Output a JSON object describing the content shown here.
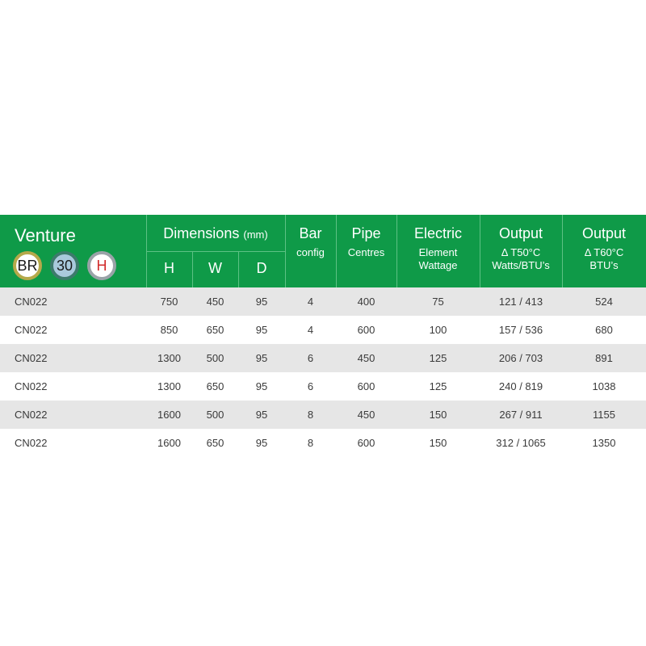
{
  "brand": {
    "title": "Venture",
    "badges": [
      {
        "label": "BR",
        "ring": "#b5a94a",
        "fill": "#ffffff",
        "text": "#1a1a1a"
      },
      {
        "label": "30",
        "ring": "#3d7a6c",
        "fill": "#a9c9dc",
        "text": "#1a1a1a"
      },
      {
        "label": "H",
        "ring": "#9aa3a8",
        "fill": "#ffffff",
        "text": "#d12c2c"
      }
    ]
  },
  "columns": {
    "dimensions": {
      "title": "Dimensions",
      "unit": "(mm)",
      "h": "H",
      "w": "W",
      "d": "D"
    },
    "bar": {
      "title": "Bar",
      "sub": "config"
    },
    "pipe": {
      "title": "Pipe",
      "sub": "Centres"
    },
    "electric": {
      "title": "Electric",
      "sub1": "Element",
      "sub2": "Wattage"
    },
    "output50": {
      "title": "Output",
      "sub1": "Δ T50°C",
      "sub2": "Watts/BTU’s"
    },
    "output60": {
      "title": "Output",
      "sub1": "Δ T60°C",
      "sub2": "BTU’s"
    }
  },
  "rows": [
    {
      "code": "CN022",
      "h": "750",
      "w": "450",
      "d": "95",
      "bar": "4",
      "pipe": "400",
      "watt": "75",
      "out50": "121 / 413",
      "out60": "524"
    },
    {
      "code": "CN022",
      "h": "850",
      "w": "650",
      "d": "95",
      "bar": "4",
      "pipe": "600",
      "watt": "100",
      "out50": "157 / 536",
      "out60": "680"
    },
    {
      "code": "CN022",
      "h": "1300",
      "w": "500",
      "d": "95",
      "bar": "6",
      "pipe": "450",
      "watt": "125",
      "out50": "206 / 703",
      "out60": "891"
    },
    {
      "code": "CN022",
      "h": "1300",
      "w": "650",
      "d": "95",
      "bar": "6",
      "pipe": "600",
      "watt": "125",
      "out50": "240 / 819",
      "out60": "1038"
    },
    {
      "code": "CN022",
      "h": "1600",
      "w": "500",
      "d": "95",
      "bar": "8",
      "pipe": "450",
      "watt": "150",
      "out50": "267 / 911",
      "out60": "1155"
    },
    {
      "code": "CN022",
      "h": "1600",
      "w": "650",
      "d": "95",
      "bar": "8",
      "pipe": "600",
      "watt": "150",
      "out50": "312 / 1065",
      "out60": "1350"
    }
  ],
  "colors": {
    "header_bg": "#0f9a48",
    "row_shade": "#e6e6e6"
  }
}
